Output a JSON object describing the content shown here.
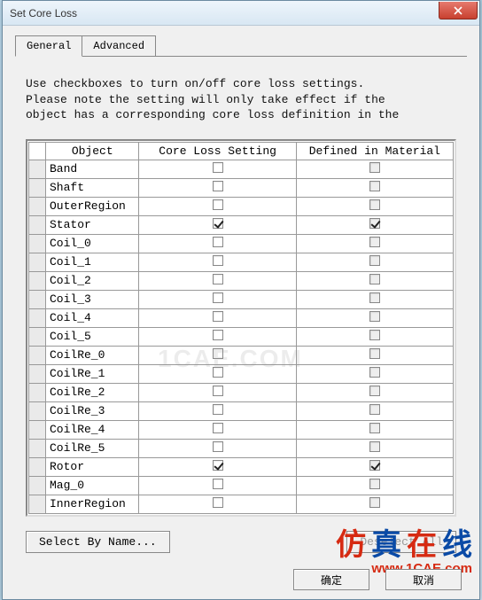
{
  "window": {
    "title": "Set Core Loss"
  },
  "tabs": {
    "general": "General",
    "advanced": "Advanced"
  },
  "instructions": "Use checkboxes to turn on/off core loss settings.\nPlease note the setting will only take effect if the\nobject has a corresponding core loss definition in the",
  "columns": {
    "object": "Object",
    "core_loss": "Core Loss Setting",
    "defined": "Defined in Material"
  },
  "rows": [
    {
      "name": "Band",
      "core_loss": false,
      "defined": false,
      "defined_disabled": true
    },
    {
      "name": "Shaft",
      "core_loss": false,
      "defined": false,
      "defined_disabled": true
    },
    {
      "name": "OuterRegion",
      "core_loss": false,
      "defined": false,
      "defined_disabled": true
    },
    {
      "name": "Stator",
      "core_loss": true,
      "defined": true,
      "defined_disabled": true
    },
    {
      "name": "Coil_0",
      "core_loss": false,
      "defined": false,
      "defined_disabled": true
    },
    {
      "name": "Coil_1",
      "core_loss": false,
      "defined": false,
      "defined_disabled": true
    },
    {
      "name": "Coil_2",
      "core_loss": false,
      "defined": false,
      "defined_disabled": true
    },
    {
      "name": "Coil_3",
      "core_loss": false,
      "defined": false,
      "defined_disabled": true
    },
    {
      "name": "Coil_4",
      "core_loss": false,
      "defined": false,
      "defined_disabled": true
    },
    {
      "name": "Coil_5",
      "core_loss": false,
      "defined": false,
      "defined_disabled": true
    },
    {
      "name": "CoilRe_0",
      "core_loss": false,
      "defined": false,
      "defined_disabled": true
    },
    {
      "name": "CoilRe_1",
      "core_loss": false,
      "defined": false,
      "defined_disabled": true
    },
    {
      "name": "CoilRe_2",
      "core_loss": false,
      "defined": false,
      "defined_disabled": true
    },
    {
      "name": "CoilRe_3",
      "core_loss": false,
      "defined": false,
      "defined_disabled": true
    },
    {
      "name": "CoilRe_4",
      "core_loss": false,
      "defined": false,
      "defined_disabled": true
    },
    {
      "name": "CoilRe_5",
      "core_loss": false,
      "defined": false,
      "defined_disabled": true
    },
    {
      "name": "Rotor",
      "core_loss": true,
      "defined": true,
      "defined_disabled": true
    },
    {
      "name": "Mag_0",
      "core_loss": false,
      "defined": false,
      "defined_disabled": true
    },
    {
      "name": "InnerRegion",
      "core_loss": false,
      "defined": false,
      "defined_disabled": true
    }
  ],
  "buttons": {
    "select_by_name": "Select By Name...",
    "deselect_all": "Deselect All",
    "ok": "确定",
    "cancel": "取消"
  },
  "branding": {
    "chars": [
      "仿",
      "真",
      "在",
      "线"
    ],
    "colors": [
      "#d62a12",
      "#0a4aa6",
      "#d62a12",
      "#0a4aa6"
    ],
    "url": "www.1CAE.com"
  },
  "watermark": "1CAE.COM"
}
